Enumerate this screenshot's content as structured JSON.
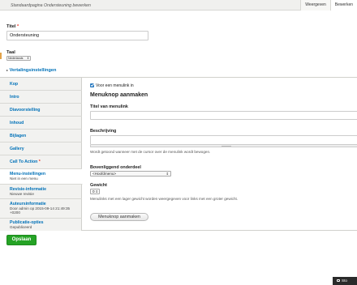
{
  "header": {
    "crumb_prefix": "Standaardpagina ",
    "crumb_title": "Ondersteuning",
    "crumb_suffix": " bewerken",
    "tabs": [
      {
        "label": "Weergeven"
      },
      {
        "label": "Bewerken"
      }
    ]
  },
  "form": {
    "title_label": "Titel",
    "required_mark": "*",
    "title_value": "Ondersteuning",
    "language_label": "Taal",
    "language_value": "Nederlands",
    "translation_link": "Vertalingsinstellingen"
  },
  "vertical_tabs": [
    {
      "title": "Kop",
      "summary": ""
    },
    {
      "title": "Intro",
      "summary": ""
    },
    {
      "title": "Diavoorstelling",
      "summary": ""
    },
    {
      "title": "Inhoud",
      "summary": ""
    },
    {
      "title": "Bijlagen",
      "summary": ""
    },
    {
      "title": "Gallery",
      "summary": ""
    },
    {
      "title": "Call To Action",
      "summary": ""
    },
    {
      "title": "Menu-instellingen",
      "summary": "Niet in een menu"
    },
    {
      "title": "Revisie-informatie",
      "summary": "Nieuwe revisie"
    },
    {
      "title": "Auteursinformatie",
      "summary": "Door admin op 2015-09-14 21:49:35 +0200"
    },
    {
      "title": "Publicatie-opties",
      "summary": "Gepubliceerd"
    }
  ],
  "menu_pane": {
    "checkbox_label": "Voor een menulink in",
    "section_title": "Menuknop aanmaken",
    "link_title_label": "Titel van menulink",
    "description_label": "Beschrijving",
    "description_help": "Wordt getoond wanneer met de cursor over de menulink wordt bewogen.",
    "parent_label": "Bovenliggend onderdeel",
    "parent_value": "<Hoofdmenu>",
    "weight_label": "Gewicht",
    "weight_value": "0",
    "weight_help": "Menulinks met een lager gewicht worden weergegeven voor links met een groter gewicht.",
    "create_button": "Menuknop aanmaken"
  },
  "actions": {
    "save_label": "Opslaan"
  },
  "corner_widget": {
    "label": "Sto"
  },
  "colors": {
    "link_blue": "#0071b8",
    "save_green": "#25a325",
    "checkbox_blue": "#2d7cc1",
    "required_red": "#ee3322"
  }
}
